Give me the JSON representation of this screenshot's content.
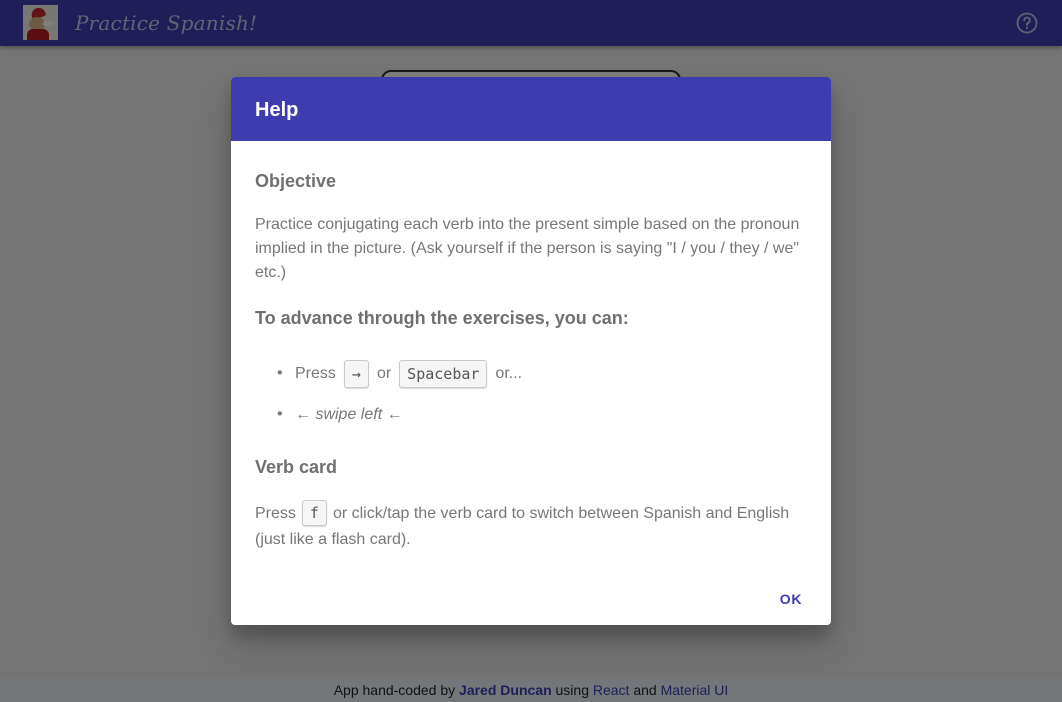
{
  "app": {
    "title": "Practice Spanish!",
    "help_icon": "help-circle-icon",
    "logo": "app-logo"
  },
  "footer": {
    "prefix": "App hand-coded by",
    "author": "Jared Duncan",
    "middle": "using",
    "link_react": "React",
    "and": "and",
    "link_mui": "Material UI"
  },
  "dialog": {
    "title": "Help",
    "objective_heading": "Objective",
    "objective_text": "Practice conjugating each verb into the present simple based on the pronoun implied in the picture. (Ask yourself if the person is saying \"I / you / they / we\" etc.)",
    "advance_heading": "To advance through the exercises, you can:",
    "advance_items": {
      "press_label": "Press",
      "key_right": "→",
      "or_label": "or",
      "key_space": "Spacebar",
      "or_more": "or...",
      "swipe_label": "← swipe left ←"
    },
    "verb_heading": "Verb card",
    "verb_press": "Press",
    "verb_key": "f",
    "verb_text": "or click/tap the verb card to switch between Spanish and English (just like a flash card).",
    "ok_label": "OK"
  },
  "colors": {
    "primary": "#3f3cb0",
    "backdrop": "rgba(0,0,0,0.5)"
  }
}
